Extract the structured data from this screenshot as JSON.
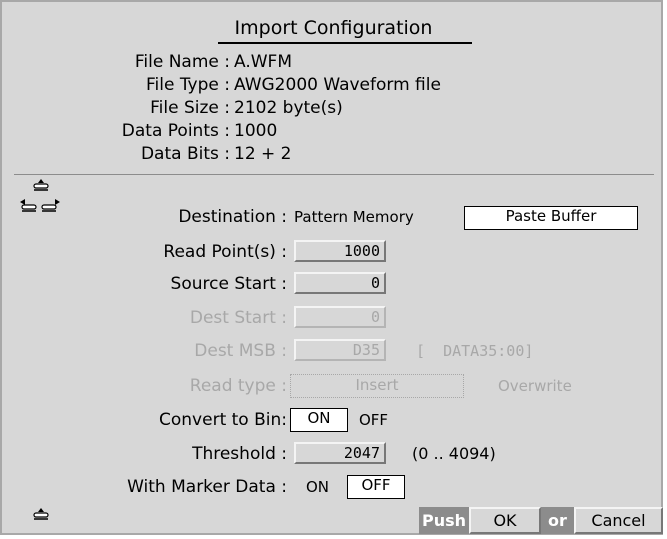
{
  "dialog": {
    "title": "Import Configuration",
    "info": [
      {
        "label": "File Name :",
        "value": "A.WFM"
      },
      {
        "label": "File Type :",
        "value": "AWG2000 Waveform file"
      },
      {
        "label": "File Size :",
        "value": "2102 byte(s)"
      },
      {
        "label": "Data Points :",
        "value": "1000"
      },
      {
        "label": "Data Bits :",
        "value": "12 + 2"
      }
    ]
  },
  "settings": {
    "destination": {
      "label": "Destination :",
      "option_1": "Pattern Memory",
      "option_2": "Paste Buffer",
      "selected": "Paste Buffer"
    },
    "read_points": {
      "label": "Read Point(s) :",
      "value": "1000"
    },
    "source_start": {
      "label": "Source Start :",
      "value": "0"
    },
    "dest_start": {
      "label": "Dest Start :",
      "value": "0",
      "enabled": false
    },
    "dest_msb": {
      "label": "Dest MSB :",
      "value": "D35",
      "range": "[  DATA35:00]",
      "enabled": false
    },
    "read_type": {
      "label": "Read type :",
      "option_1": "Insert",
      "option_2": "Overwrite",
      "selected": "Insert",
      "enabled": false
    },
    "convert_to_bin": {
      "label": "Convert to Bin:",
      "on": "ON",
      "off": "OFF",
      "selected": "ON"
    },
    "threshold": {
      "label": "Threshold :",
      "value": "2047",
      "range": "(0 .. 4094)"
    },
    "with_marker_data": {
      "label": "With Marker Data :",
      "on": "ON",
      "off": "OFF",
      "selected": "OFF"
    }
  },
  "footer": {
    "push": "Push",
    "ok": "OK",
    "or": "or",
    "cancel": "Cancel"
  },
  "colors": {
    "panel_bg": "#d7d7d7",
    "disabled_text": "#a8a8a8",
    "push_bar": "#8c8c8c"
  }
}
